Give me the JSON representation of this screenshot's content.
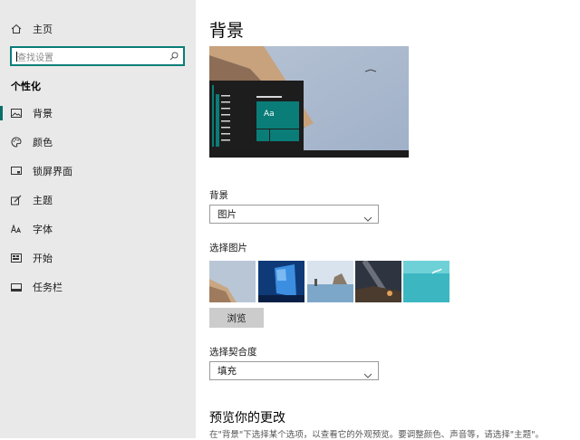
{
  "sidebar": {
    "home_label": "主页",
    "search_placeholder": "查找设置",
    "section_title": "个性化",
    "items": [
      {
        "label": "背景",
        "icon": "picture-icon"
      },
      {
        "label": "颜色",
        "icon": "palette-icon"
      },
      {
        "label": "锁屏界面",
        "icon": "lock-screen-icon"
      },
      {
        "label": "主题",
        "icon": "themes-icon"
      },
      {
        "label": "字体",
        "icon": "font-icon"
      },
      {
        "label": "开始",
        "icon": "start-icon"
      },
      {
        "label": "任务栏",
        "icon": "taskbar-icon"
      }
    ]
  },
  "main": {
    "title": "背景",
    "preview_tile_text": "Aa",
    "background_label": "背景",
    "background_value": "图片",
    "choose_picture_label": "选择图片",
    "browse_label": "浏览",
    "fit_label": "选择契合度",
    "fit_value": "填充",
    "preview_changes_title": "预览你的更改",
    "preview_changes_desc": "在\"背景\"下选择某个选项，以查看它的外观预览。要调整颜色、声音等，请选择\"主题\"。"
  },
  "colors": {
    "accent": "#0a7d78",
    "sidebar_bg": "#e9e9e9"
  }
}
